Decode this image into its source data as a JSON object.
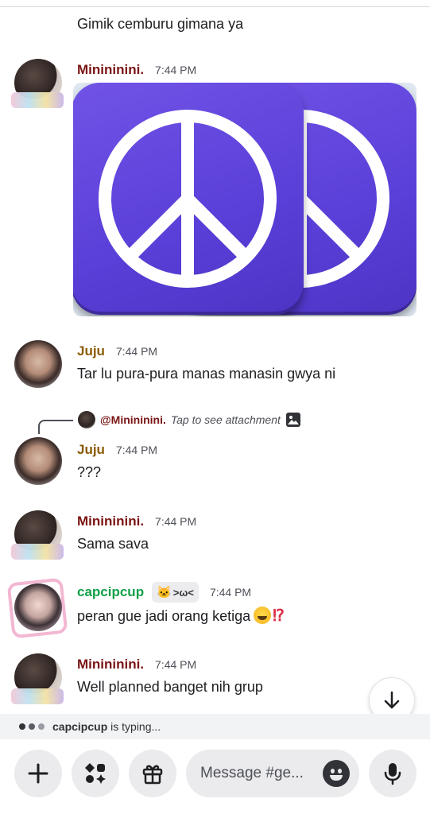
{
  "continuation": {
    "text": "Gimik cemburu gimana ya"
  },
  "messages": [
    {
      "author": "Minininini.",
      "time": "7:44 PM",
      "attachment": "image"
    },
    {
      "author": "Juju",
      "time": "7:44 PM",
      "text": "Tar lu pura-pura manas manasin gwya ni"
    },
    {
      "author": "Juju",
      "time": "7:44 PM",
      "text": "???",
      "reply": {
        "author": "@Minininini.",
        "tap_text": "Tap to see attachment"
      }
    },
    {
      "author": "Minininini.",
      "time": "7:44 PM",
      "text": "Sama sava"
    },
    {
      "author": "capcipcup",
      "tag": ">ω<",
      "time": "7:44 PM",
      "text": "peran gue jadi orang ketiga",
      "trailing": "⁉"
    },
    {
      "author": "Minininini.",
      "time": "7:44 PM",
      "text": "Well planned banget nih grup"
    }
  ],
  "typing": {
    "user": "capcipcup",
    "suffix": " is typing..."
  },
  "composer": {
    "placeholder": "Message #ge..."
  },
  "colors": {
    "mini": "#7a1414",
    "juju": "#8a5a00",
    "capcip": "#13a048",
    "tile": "#5a3fd8"
  }
}
